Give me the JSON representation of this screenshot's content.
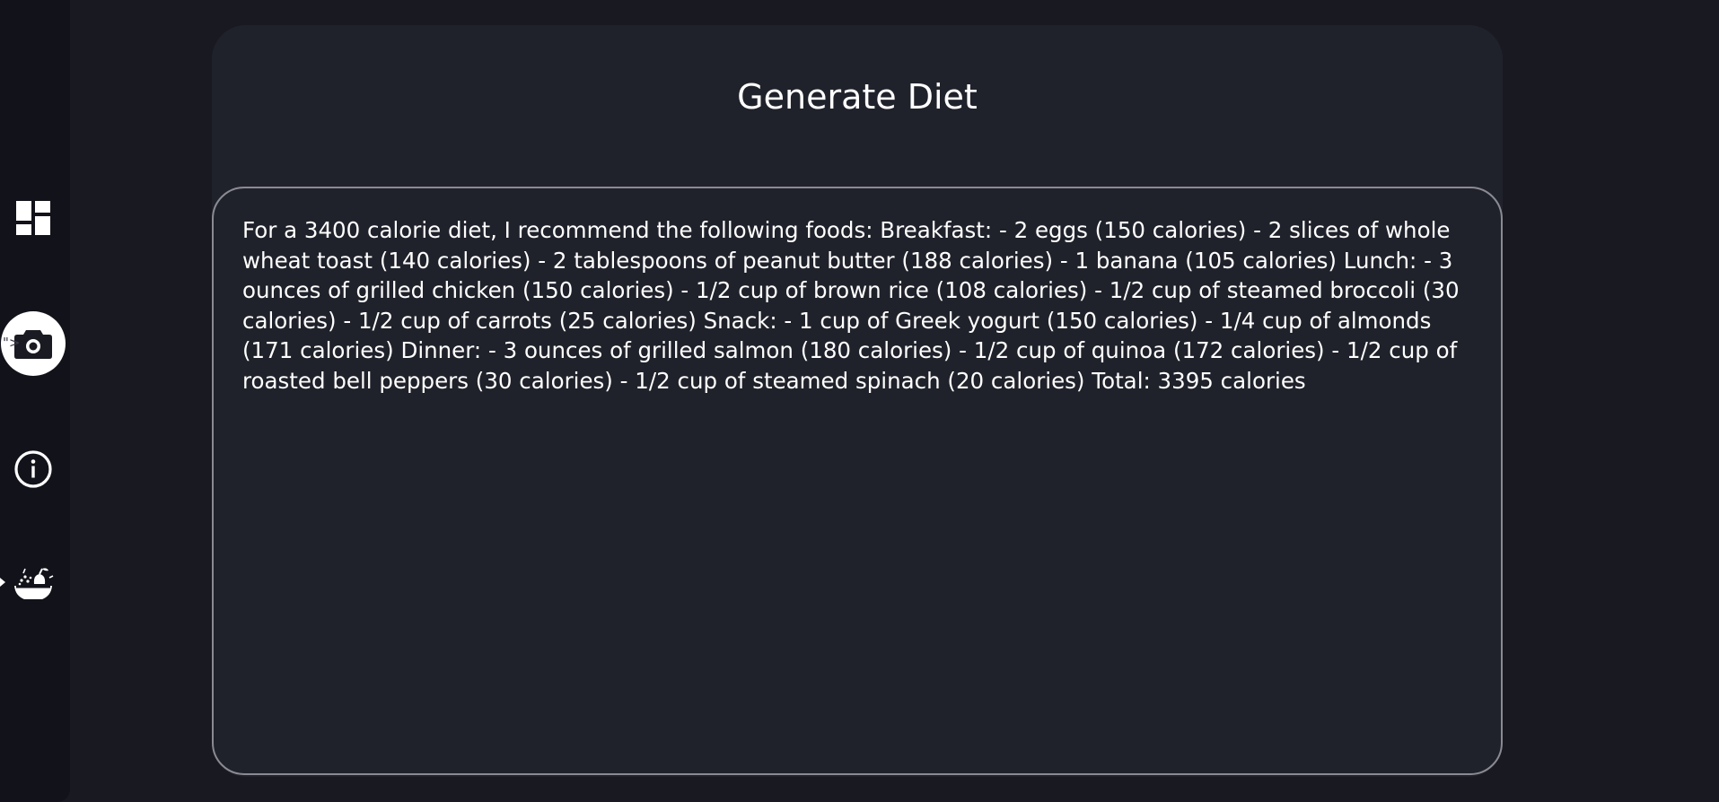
{
  "sidebar": {
    "items": [
      {
        "icon": "dashboard-icon"
      },
      {
        "icon": "camera-icon",
        "active": true
      },
      {
        "icon": "info-icon"
      },
      {
        "icon": "fruit-bowl-icon"
      }
    ],
    "stray_text": "\">",
    "colors": {
      "background": "#12121a",
      "active": "#ffffff"
    }
  },
  "main": {
    "title": "Generate Diet",
    "output": "For a 3400 calorie diet, I recommend the following foods: Breakfast: - 2 eggs (150 calories) - 2 slices of whole wheat toast (140 calories) - 2 tablespoons of peanut butter (188 calories) - 1 banana (105 calories) Lunch: - 3 ounces of grilled chicken (150 calories) - 1/2 cup of brown rice (108 calories) - 1/2 cup of steamed broccoli (30 calories) - 1/2 cup of carrots (25 calories) Snack: - 1 cup of Greek yogurt (150 calories) - 1/4 cup of almonds (171 calories) Dinner: - 3 ounces of grilled salmon (180 calories) - 1/2 cup of quinoa (172 calories) - 1/2 cup of roasted bell peppers (30 calories) - 1/2 cup of steamed spinach (20 calories) Total: 3395 calories"
  },
  "colors": {
    "page_background": "#191922",
    "card_background": "#20222b",
    "box_border": "#8a8a92",
    "text": "#ffffff"
  }
}
